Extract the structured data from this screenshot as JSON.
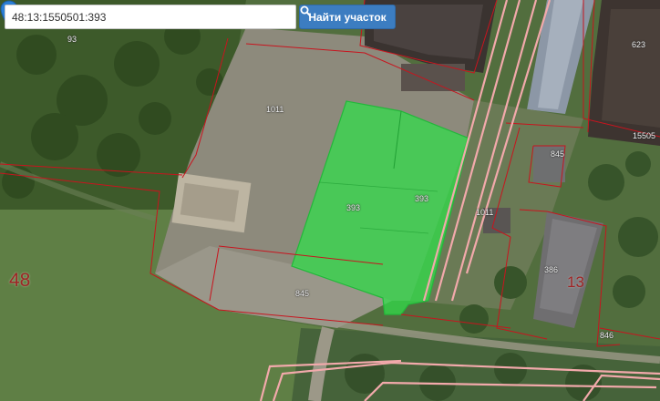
{
  "search": {
    "value": "48:13:1550501:393",
    "button_label": "Найти участок",
    "button_icon": "search-icon"
  },
  "map": {
    "parcel_labels": [
      "93",
      "1011",
      "393",
      "393",
      "1011",
      "845",
      "845",
      "386",
      "846",
      "623",
      "15505"
    ],
    "quarter_labels": [
      "48",
      "13"
    ],
    "selected_parcel_color": "#2fe04a",
    "boundary_color": "#c8141e",
    "road_color": "#f0a9a9",
    "marker_icon": "map-marker-icon"
  }
}
